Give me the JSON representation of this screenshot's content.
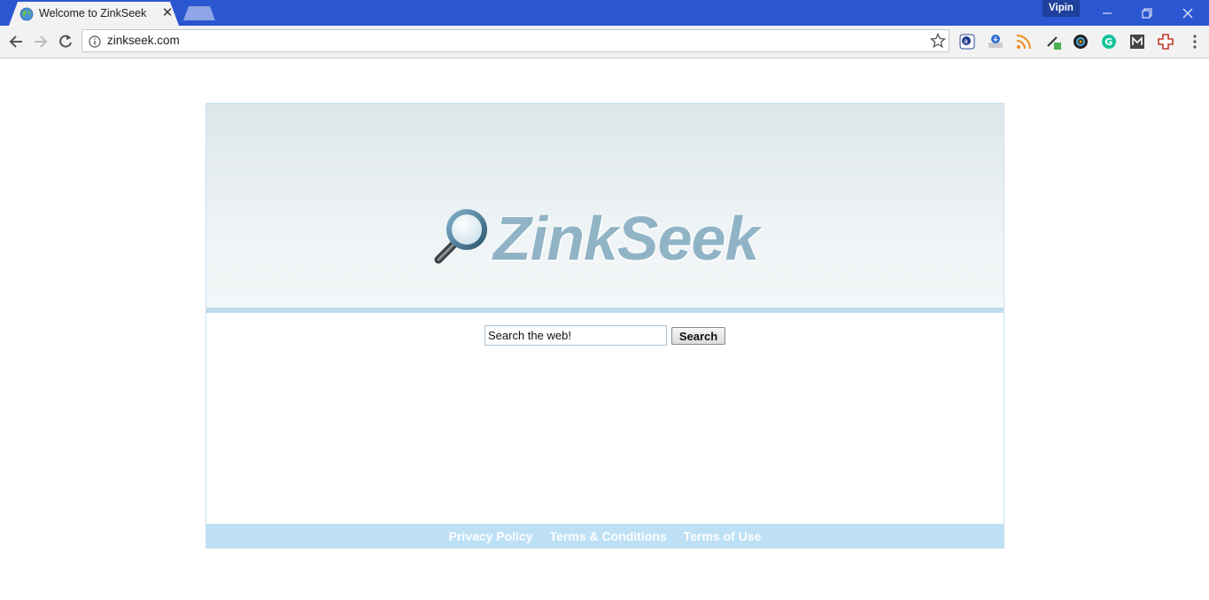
{
  "browser": {
    "tab_title": "Welcome to ZinkSeek",
    "profile_name": "Vipin",
    "url": "zinkseek.com",
    "nav_icons": [
      "back-icon",
      "forward-icon",
      "reload-icon"
    ],
    "extension_icons": [
      "amazon-assistant-icon",
      "download-manager-icon",
      "rss-icon",
      "color-picker-icon",
      "camera-icon",
      "grammarly-icon",
      "mega-icon",
      "plus-extension-icon",
      "menu-icon"
    ],
    "titlebar_color": "#2b56d1"
  },
  "page": {
    "logo_text": "ZinkSeek",
    "search": {
      "value": "Search the web!",
      "button_label": "Search"
    },
    "footer": {
      "links": [
        "Privacy Policy",
        "Terms & Conditions",
        "Terms of Use"
      ]
    },
    "colors": {
      "logo": "#90b4c6",
      "footer_bg": "#bde0f5",
      "divider": "#bfdcef"
    }
  }
}
